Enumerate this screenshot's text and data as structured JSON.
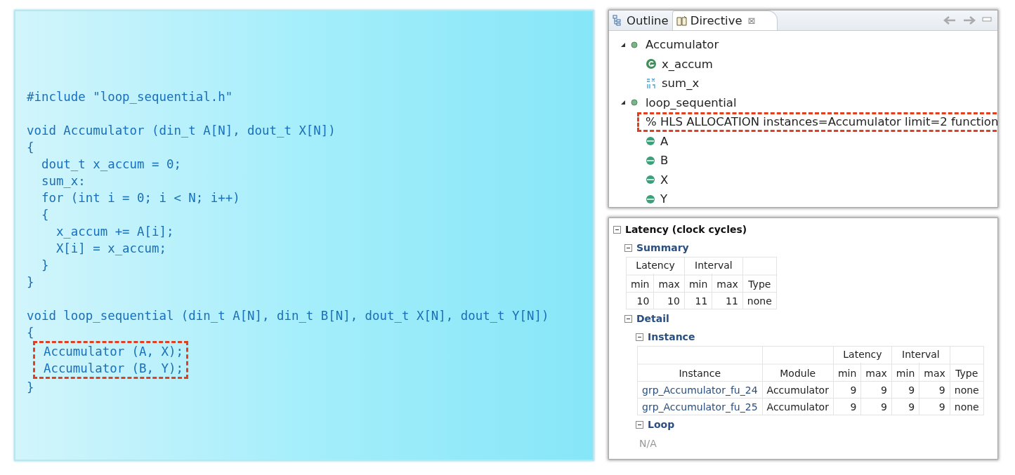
{
  "code": {
    "lines": [
      {
        "kind": "line",
        "text": "#include \"loop_sequential.h\""
      },
      {
        "kind": "blank"
      },
      {
        "kind": "line",
        "text": "void Accumulator (din_t A[N], dout_t X[N])"
      },
      {
        "kind": "line",
        "text": "{"
      },
      {
        "kind": "line",
        "text": "  dout_t x_accum = 0;"
      },
      {
        "kind": "line",
        "text": "  sum_x:"
      },
      {
        "kind": "line",
        "text": "  for (int i = 0; i < N; i++)"
      },
      {
        "kind": "line",
        "text": "  {"
      },
      {
        "kind": "line",
        "text": "    x_accum += A[i];"
      },
      {
        "kind": "line",
        "text": "    X[i] = x_accum;"
      },
      {
        "kind": "line",
        "text": "  }"
      },
      {
        "kind": "line",
        "text": "}"
      },
      {
        "kind": "blank"
      },
      {
        "kind": "line",
        "text": "void loop_sequential (din_t A[N], din_t B[N], dout_t X[N], dout_t Y[N])"
      },
      {
        "kind": "line",
        "text": "{"
      },
      {
        "kind": "highlight",
        "lines": [
          "  Accumulator (A, X);",
          "  Accumulator (B, Y);"
        ]
      },
      {
        "kind": "line",
        "text": "}"
      }
    ]
  },
  "tabs": [
    {
      "label": "Outline",
      "selected": false
    },
    {
      "label": "Directive",
      "selected": true,
      "close": "⊠"
    }
  ],
  "tree": [
    {
      "label": "Accumulator",
      "kind": "function",
      "expanded": true,
      "children": [
        {
          "label": "x_accum",
          "kind": "variable"
        },
        {
          "label": "sum_x",
          "kind": "loop"
        }
      ]
    },
    {
      "label": "loop_sequential",
      "kind": "function",
      "expanded": true,
      "children": [
        {
          "label": "% HLS ALLOCATION instances=Accumulator limit=2 function",
          "kind": "directive"
        },
        {
          "label": "A",
          "kind": "port"
        },
        {
          "label": "B",
          "kind": "port"
        },
        {
          "label": "X",
          "kind": "port"
        },
        {
          "label": "Y",
          "kind": "port"
        }
      ]
    }
  ],
  "report": {
    "title": "Latency (clock cycles)",
    "children": [
      {
        "title": "Summary",
        "table": {
          "columns": [
            {
              "label": "min",
              "group": "Latency"
            },
            {
              "label": "max",
              "grouped": true
            },
            {
              "label": "min",
              "group": "Interval"
            },
            {
              "label": "max",
              "grouped": true
            },
            {
              "label": "Type"
            }
          ],
          "rows": [
            [
              "10",
              "10",
              "11",
              "11",
              "none"
            ]
          ]
        }
      },
      {
        "title": "Detail",
        "children": [
          {
            "title": "Instance",
            "table": {
              "columns": [
                {
                  "label": "Instance"
                },
                {
                  "label": "Module"
                },
                {
                  "label": "min",
                  "group": "Latency"
                },
                {
                  "label": "max",
                  "grouped": true
                },
                {
                  "label": "min",
                  "group": "Interval"
                },
                {
                  "label": "max",
                  "grouped": true
                },
                {
                  "label": "Type"
                }
              ],
              "rows": [
                [
                  "grp_Accumulator_fu_24",
                  "Accumulator",
                  "9",
                  "9",
                  "9",
                  "9",
                  "none"
                ],
                [
                  "grp_Accumulator_fu_25",
                  "Accumulator",
                  "9",
                  "9",
                  "9",
                  "9",
                  "none"
                ]
              ]
            }
          },
          {
            "title": "Loop",
            "note": "N/A"
          }
        ]
      }
    ]
  }
}
